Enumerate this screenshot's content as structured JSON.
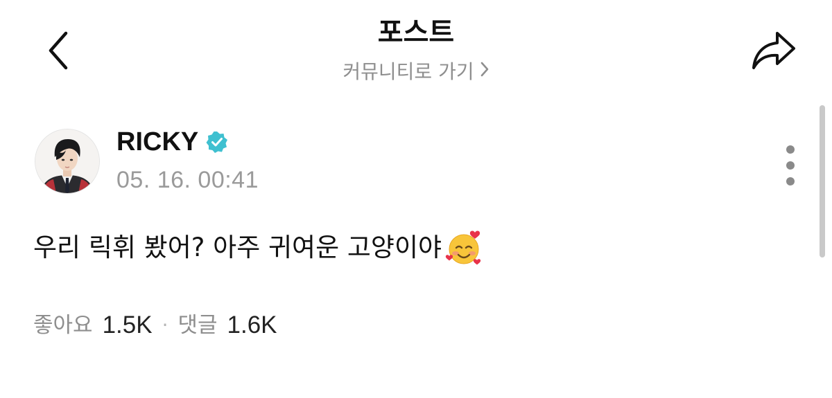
{
  "header": {
    "title": "포스트",
    "community_link": "커뮤니티로 가기",
    "icons": {
      "back": "chevron-left-icon",
      "share": "share-arrow-icon",
      "more": "more-vertical-icon"
    }
  },
  "post": {
    "author": {
      "name": "RICKY",
      "verified": true,
      "verified_color": "#3fc0d0",
      "avatar": "profile-photo"
    },
    "timestamp": "05. 16. 00:41",
    "body": "우리 릭휘 봤어? 아주 귀여운 고양이야",
    "body_emoji": "smiling-face-with-hearts",
    "stats": {
      "likes_label": "좋아요",
      "likes_value": "1.5K",
      "separator": "·",
      "comments_label": "댓글",
      "comments_value": "1.6K"
    }
  },
  "colors": {
    "text_primary": "#111111",
    "text_secondary": "#8e8e8e",
    "scrollbar": "#c9c9c9",
    "background": "#ffffff"
  }
}
